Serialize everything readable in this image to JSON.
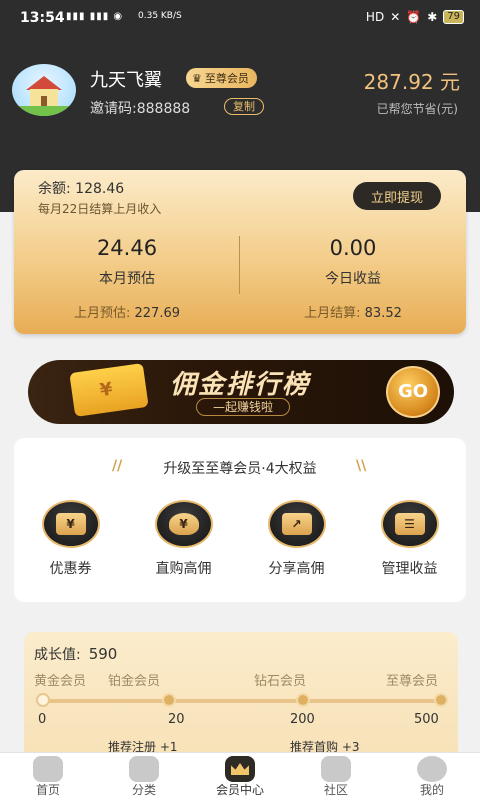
{
  "status_bar": {
    "time": "13:54",
    "net_speed": "0.35 KB/S",
    "hd_label": "HD",
    "battery": "79"
  },
  "profile": {
    "name": "九天飞翼",
    "vip_badge": "至尊会员",
    "invite_label": "邀请码:888888",
    "copy_label": "复制",
    "saved_amount": "287.92 元",
    "saved_label": "已帮您节省(元)"
  },
  "balance_card": {
    "balance_label": "余额: 128.46",
    "settle_note": "每月22日结算上月收入",
    "withdraw_label": "立即提现",
    "month_estimate_value": "24.46",
    "month_estimate_label": "本月预估",
    "last_month_estimate_label": "上月预估:",
    "last_month_estimate_value": "227.69",
    "today_value": "0.00",
    "today_label": "今日收益",
    "last_month_settled_label": "上月结算:",
    "last_month_settled_value": "83.52"
  },
  "banner": {
    "title": "佣金排行榜",
    "subtitle": "—起赚钱啦",
    "go_label": "GO",
    "wallet_glyph": "¥"
  },
  "benefits": {
    "title": "升级至至尊会员·4大权益",
    "items": [
      {
        "label": "优惠券",
        "icon": "coupon-icon",
        "glyph": "¥"
      },
      {
        "label": "直购高佣",
        "icon": "money-bag-icon",
        "glyph": "¥"
      },
      {
        "label": "分享高佣",
        "icon": "share-icon",
        "glyph": "↗"
      },
      {
        "label": "管理收益",
        "icon": "user-manage-icon",
        "glyph": "☰"
      }
    ]
  },
  "growth": {
    "label": "成长值:",
    "value": "590",
    "levels": [
      "黄金会员",
      "铂金会员",
      "钻石会员",
      "至尊会员"
    ],
    "ticks": [
      "0",
      "20",
      "200",
      "500"
    ],
    "tasks": [
      "推荐注册 +1",
      "推荐首购 +3"
    ]
  },
  "tab_bar": {
    "tabs": [
      {
        "label": "首页",
        "icon": "home-icon"
      },
      {
        "label": "分类",
        "icon": "category-icon"
      },
      {
        "label": "会员中心",
        "icon": "crown-icon",
        "active": true
      },
      {
        "label": "社区",
        "icon": "community-icon"
      },
      {
        "label": "我的",
        "icon": "profile-icon"
      }
    ]
  },
  "colors": {
    "header_bg": "#2d2d2d",
    "gold_accent": "#f1c27d",
    "card_gold": "#f3cd8a"
  }
}
